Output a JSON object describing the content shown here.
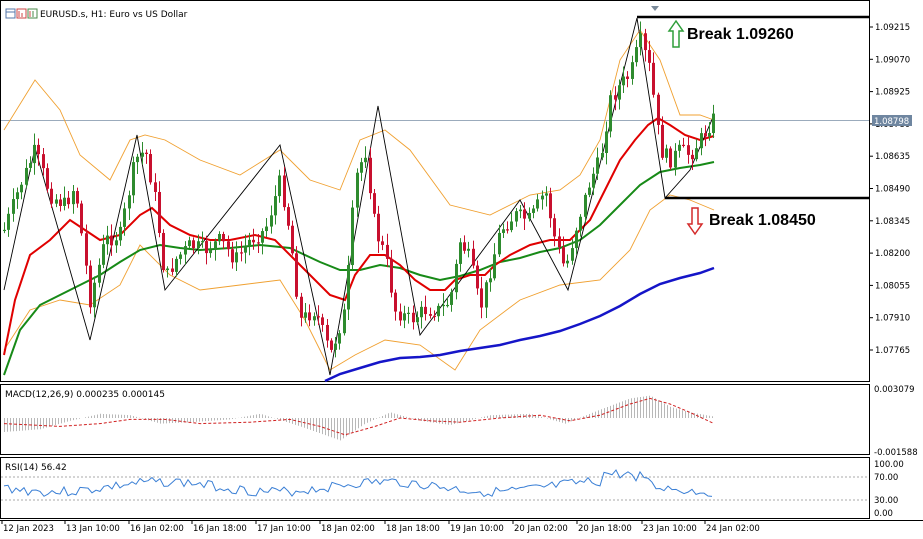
{
  "title": "EURUSD.s, H1:  Euro vs US Dollar",
  "current_price": "1.08798",
  "price_ticks": [
    "1.09215",
    "1.09070",
    "1.08925",
    "1.08780",
    "1.08635",
    "1.08490",
    "1.08345",
    "1.08200",
    "1.08055",
    "1.07910",
    "1.07765"
  ],
  "annotations": {
    "break_up": "Break 1.09260",
    "break_down": "Break 1.08450"
  },
  "macd": {
    "label": "MACD(12,26,9) 0.000235 0.000145",
    "top": "0.003079",
    "bottom": "-0.001588"
  },
  "rsi": {
    "label": "RSI(14) 56.42",
    "ticks": [
      "100.00",
      "70.00",
      "30.00",
      "0.00"
    ]
  },
  "time_ticks": [
    "12 Jan 2023",
    "13 Jan 10:00",
    "16 Jan 02:00",
    "16 Jan 18:00",
    "17 Jan 10:00",
    "18 Jan 02:00",
    "18 Jan 18:00",
    "19 Jan 10:00",
    "20 Jan 02:00",
    "20 Jan 18:00",
    "23 Jan 10:00",
    "24 Jan 02:00"
  ],
  "colors": {
    "bull": "#2e8b2e",
    "bear": "#c8102e",
    "bollinger": "#f0a030",
    "ma_fast": "#e00000",
    "ma_mid": "#178a17",
    "ma_slow": "#1515c8",
    "signal": "#d02020",
    "rsi_line": "#3a7fd5"
  },
  "icons": [
    "chart-window-icon",
    "chart-bars-icon",
    "chart-grid-icon"
  ]
}
